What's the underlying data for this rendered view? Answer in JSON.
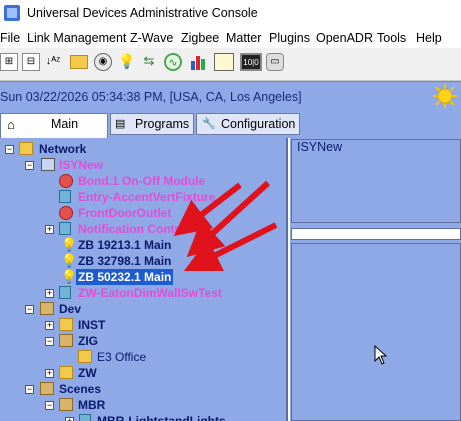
{
  "window": {
    "title": "Universal Devices Administrative Console"
  },
  "menu": [
    "File",
    "Link Management",
    "Z-Wave",
    "Zigbee",
    "Matter",
    "Plugins",
    "OpenADR",
    "Tools",
    "Help"
  ],
  "status": {
    "datetime": "Sun 03/22/2026 05:34:38 PM,  [USA, CA, Los Angeles]"
  },
  "tabs": {
    "main": "Main",
    "programs": "Programs",
    "configuration": "Configuration"
  },
  "tree": {
    "network": "Network",
    "isynew": "ISYNew",
    "items": [
      "Bond.1 On-Off Module",
      "Entry-AccentVertFixture",
      "FrontDoorOutlet",
      "Notification Controller",
      "ZB 19213.1 Main",
      "ZB 32798.1 Main",
      "ZB 50232.1 Main",
      "ZW-EatonDimWallSwTest"
    ],
    "dev": "Dev",
    "inst": "INST",
    "zig": "ZIG",
    "e3office": "E3 Office",
    "zw": "ZW",
    "scenes": "Scenes",
    "mbr": "MBR",
    "mbr_lights": "MBR-LightstandLights"
  },
  "right_panel": {
    "title": "ISYNew"
  },
  "colors": {
    "panel_bg": "#8fa9e6",
    "accent_magenta": "#e64bd8",
    "tree_text": "#0c1a6e",
    "selection": "#1d5bd0",
    "arrow_red": "#e0121b"
  }
}
